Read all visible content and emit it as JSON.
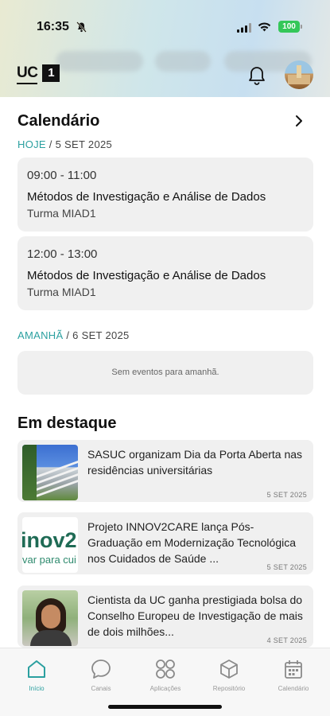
{
  "status_bar": {
    "time": "16:35",
    "battery": "100"
  },
  "header": {
    "logo_text": "UC",
    "logo_badge": "1",
    "icons": [
      "bell-icon",
      "profile-avatar"
    ]
  },
  "calendar": {
    "title": "Calendário",
    "today_label": "HOJE",
    "today_date": "/ 5 SET 2025",
    "events": [
      {
        "time": "09:00 - 11:00",
        "name": "Métodos de Investigação e Análise de Dados",
        "group": "Turma MIAD1"
      },
      {
        "time": "12:00 - 13:00",
        "name": "Métodos de Investigação e Análise de Dados",
        "group": "Turma MIAD1"
      }
    ],
    "tomorrow_label": "AMANHÃ",
    "tomorrow_date": "/ 6 SET 2025",
    "tomorrow_empty": "Sem eventos para amanhã."
  },
  "featured": {
    "title": "Em destaque",
    "items": [
      {
        "text": "SASUC organizam Dia da Porta Aberta nas residências universitárias",
        "date": "5 SET 2025"
      },
      {
        "text": "Projeto INNOV2CARE lança Pós-Graduação em Modernização Tecnológica nos Cuidados de Saúde ...",
        "date": "5 SET 2025",
        "thumb_text": "inov2",
        "thumb_sub": "var para cui"
      },
      {
        "text": "Cientista da UC ganha prestigiada bolsa do Conselho Europeu de Investigação de mais de dois milhões...",
        "date": "4 SET 2025"
      }
    ]
  },
  "tabbar": {
    "tabs": [
      {
        "label": "Início",
        "icon": "home-icon",
        "active": true
      },
      {
        "label": "Canais",
        "icon": "chat-icon",
        "active": false
      },
      {
        "label": "Aplicações",
        "icon": "apps-icon",
        "active": false
      },
      {
        "label": "Repositório",
        "icon": "box-icon",
        "active": false
      },
      {
        "label": "Calendário",
        "icon": "calendar-icon",
        "active": false
      }
    ]
  },
  "colors": {
    "accent": "#2ba0a0",
    "card": "#f0f0f0",
    "battery": "#34c759"
  }
}
